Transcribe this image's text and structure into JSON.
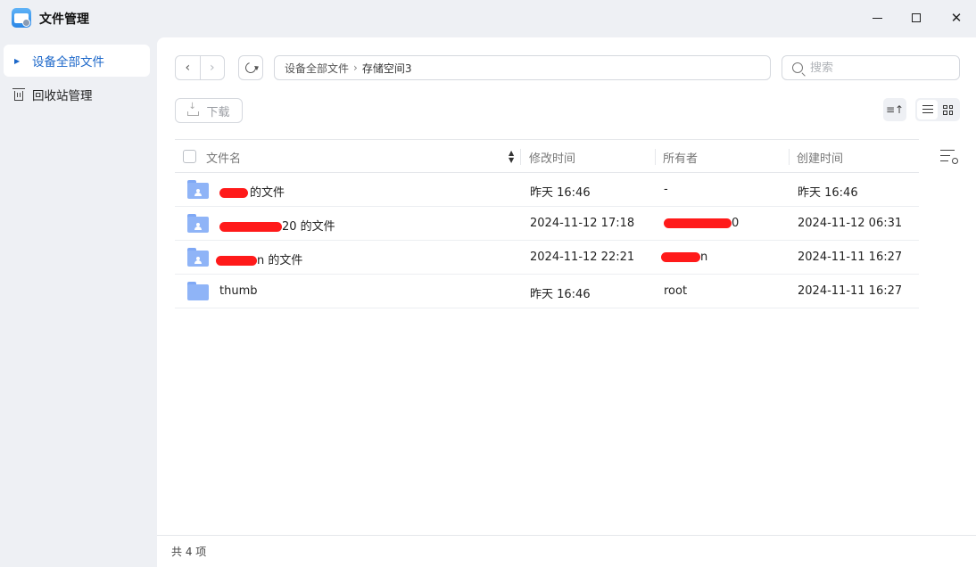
{
  "app": {
    "title": "文件管理",
    "icon": "file-manager-app-icon"
  },
  "window_controls": {
    "minimize": "minimize-icon",
    "maximize": "maximize-icon",
    "close": "✕"
  },
  "sidebar": {
    "items": [
      {
        "label": "设备全部文件",
        "icon": "caret-right-icon",
        "active": true
      },
      {
        "label": "回收站管理",
        "icon": "trash-icon",
        "active": false
      }
    ]
  },
  "toolbar": {
    "back": "‹",
    "forward": "›",
    "breadcrumb": [
      "设备全部文件",
      "存储空间3"
    ],
    "breadcrumb_sep": "›",
    "search_placeholder": "搜索",
    "download_label": "下载",
    "sort_label": "≡↑"
  },
  "table": {
    "columns": [
      "文件名",
      "修改时间",
      "所有者",
      "创建时间"
    ],
    "rows": [
      {
        "name_suffix": "的文件",
        "modified": "昨天 16:46",
        "owner": "-",
        "created": "昨天 16:46",
        "shared_user": true
      },
      {
        "name_suffix": "20 的文件",
        "modified": "2024-11-12 17:18",
        "owner_suffix": "0",
        "created": "2024-11-12 06:31",
        "shared_user": true
      },
      {
        "name_prefix": "n 的文件",
        "modified": "2024-11-12 22:21",
        "owner_suffix": "n",
        "created": "2024-11-11 16:27",
        "shared_user": true
      },
      {
        "name": "thumb",
        "modified": "昨天 16:46",
        "owner": "root",
        "created": "2024-11-11 16:27",
        "shared_user": false
      }
    ]
  },
  "footer": {
    "count": "共 4 项"
  },
  "colors": {
    "accent": "#1a66c9",
    "folder": "#8fb4f7",
    "redaction": "#ff1a1a"
  }
}
